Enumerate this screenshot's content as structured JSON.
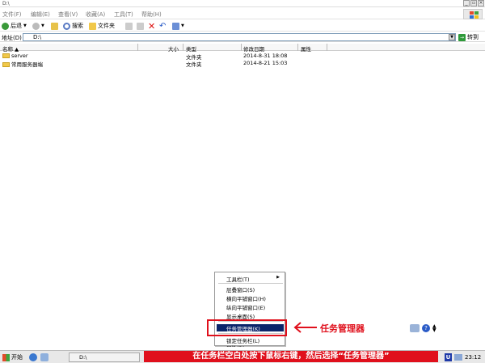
{
  "window": {
    "title": "D:\\"
  },
  "menubar": {
    "items": [
      "文件(F)",
      "编辑(E)",
      "查看(V)",
      "收藏(A)",
      "工具(T)",
      "帮助(H)"
    ]
  },
  "toolbar": {
    "back_label": "后退",
    "search_label": "搜索",
    "folders_label": "文件夹"
  },
  "addressbar": {
    "label": "地址(D)",
    "path": "D:\\",
    "go_label": "转到"
  },
  "columns": {
    "name": "名称 ▲",
    "size": "大小",
    "type": "类型",
    "modified": "修改日期",
    "attributes": "属性"
  },
  "files": [
    {
      "name": "server",
      "size": "",
      "type": "文件夹",
      "modified": "2014-8-31 18:08",
      "attributes": ""
    },
    {
      "name": "常用服务器端",
      "size": "",
      "type": "文件夹",
      "modified": "2014-8-21 15:03",
      "attributes": ""
    }
  ],
  "context_menu": {
    "toolbars": "工具栏(T)",
    "cascade": "层叠窗口(S)",
    "tile_h": "横向平铺窗口(H)",
    "tile_v": "纵向平铺窗口(E)",
    "show_desktop": "显示桌面(S)",
    "task_manager": "任务管理器(K)",
    "lock_taskbar": "锁定任务栏(L)",
    "properties": "属性(R)"
  },
  "annotation": {
    "callout": "任务管理器",
    "banner": "在任务栏空白处按下鼠标右键，然后选择“任务管理器”"
  },
  "taskbar": {
    "start_label": "开始",
    "task_label": "D:\\",
    "clock": "23:12"
  },
  "colors": {
    "highlight": "#0a246a",
    "annotation_red": "#e0101c"
  }
}
